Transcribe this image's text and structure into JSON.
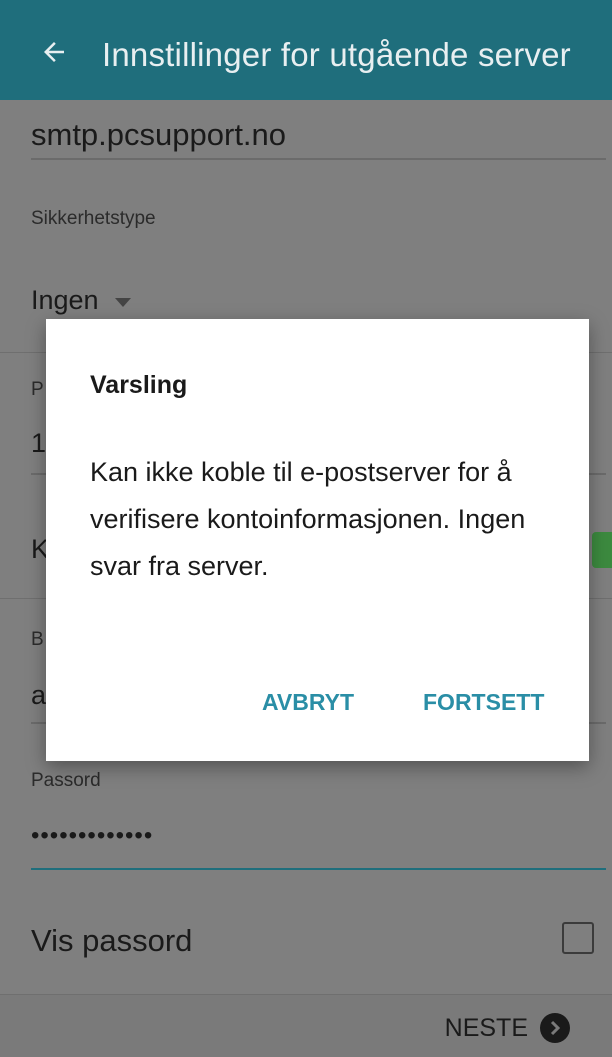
{
  "appbar": {
    "title": "Innstillinger for utgående server"
  },
  "form": {
    "server_value": "smtp.pcsupport.no",
    "security_label": "Sikkerhetstype",
    "security_value": "Ingen",
    "port_label_partial": "P",
    "port_value_partial": "1",
    "auth_label_partial": "K",
    "username_label_partial": "B",
    "username_value_partial": "a",
    "password_label": "Passord",
    "password_value": "•••••••••••••",
    "show_password_label": "Vis passord",
    "show_password_checked": false
  },
  "footer": {
    "next_label": "NESTE"
  },
  "dialog": {
    "title": "Varsling",
    "message": "Kan ikke koble til e-postserver for å verifisere kontoinformasjonen. Ingen svar fra server.",
    "cancel_label": "AVBRYT",
    "continue_label": "FORTSETT"
  },
  "colors": {
    "appbar_bg": "#1f6e7c",
    "accent_button": "#2a8ea6",
    "toggle_on": "#3c8a3f"
  }
}
